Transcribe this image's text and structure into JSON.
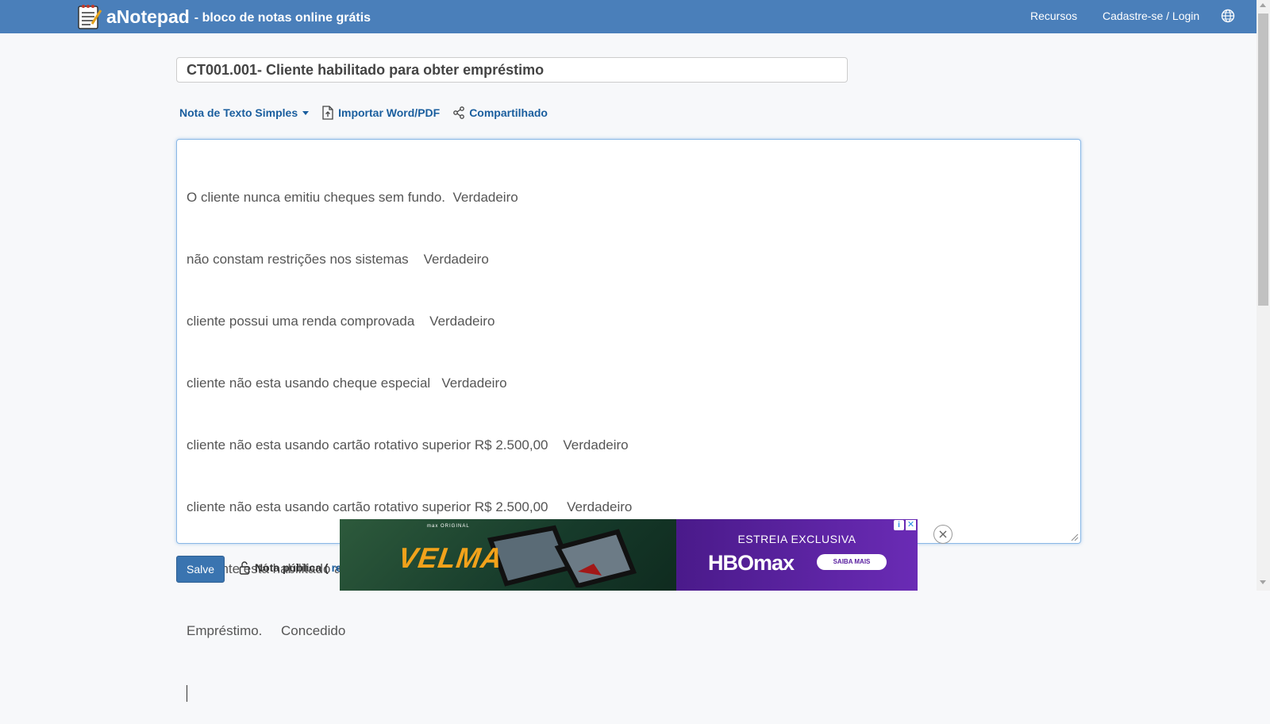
{
  "header": {
    "brand_name": "aNotepad",
    "tagline": "- bloco de notas online grátis",
    "nav": {
      "resources": "Recursos",
      "login": "Cadastre-se / Login"
    },
    "bg_color": "#4a7fba"
  },
  "note": {
    "title": "CT001.001- Cliente habilitado para obter empréstimo",
    "lines": [
      "O cliente nunca emitiu cheques sem fundo.  Verdadeiro",
      "não constam restrições nos sistemas    Verdadeiro",
      "cliente possui uma renda comprovada    Verdadeiro",
      "cliente não esta usando cheque especial   Verdadeiro",
      "cliente não esta usando cartão rotativo superior R$ 2.500,00    Verdadeiro",
      "cliente não esta usando cartão rotativo superior R$ 2.500,00     Verdadeiro",
      "O cliente está habilitado a  pegar o empréstimo ?    sim",
      "Empréstimo.     Concedido"
    ]
  },
  "toolbar": {
    "note_type": "Nota de Texto Simples",
    "import": "Importar Word/PDF",
    "share": "Compartilhado"
  },
  "footer": {
    "save_label": "Salve",
    "visibility_label": "Nota pública (",
    "visibility_link": "re"
  },
  "ad": {
    "small_text": "max ORIGINAL",
    "art_title": "VELMA",
    "headline": "ESTREIA EXCLUSIVA",
    "logo": "HBOmax",
    "cta": "SAIBA MAIS",
    "info_icon": "i",
    "close_icon": "✕"
  },
  "icons": {
    "brand": "notepad-icon",
    "globe": "globe-icon",
    "import": "file-upload-icon",
    "share": "share-icon",
    "lock": "lock-icon",
    "ad_close": "close-circle-icon"
  }
}
